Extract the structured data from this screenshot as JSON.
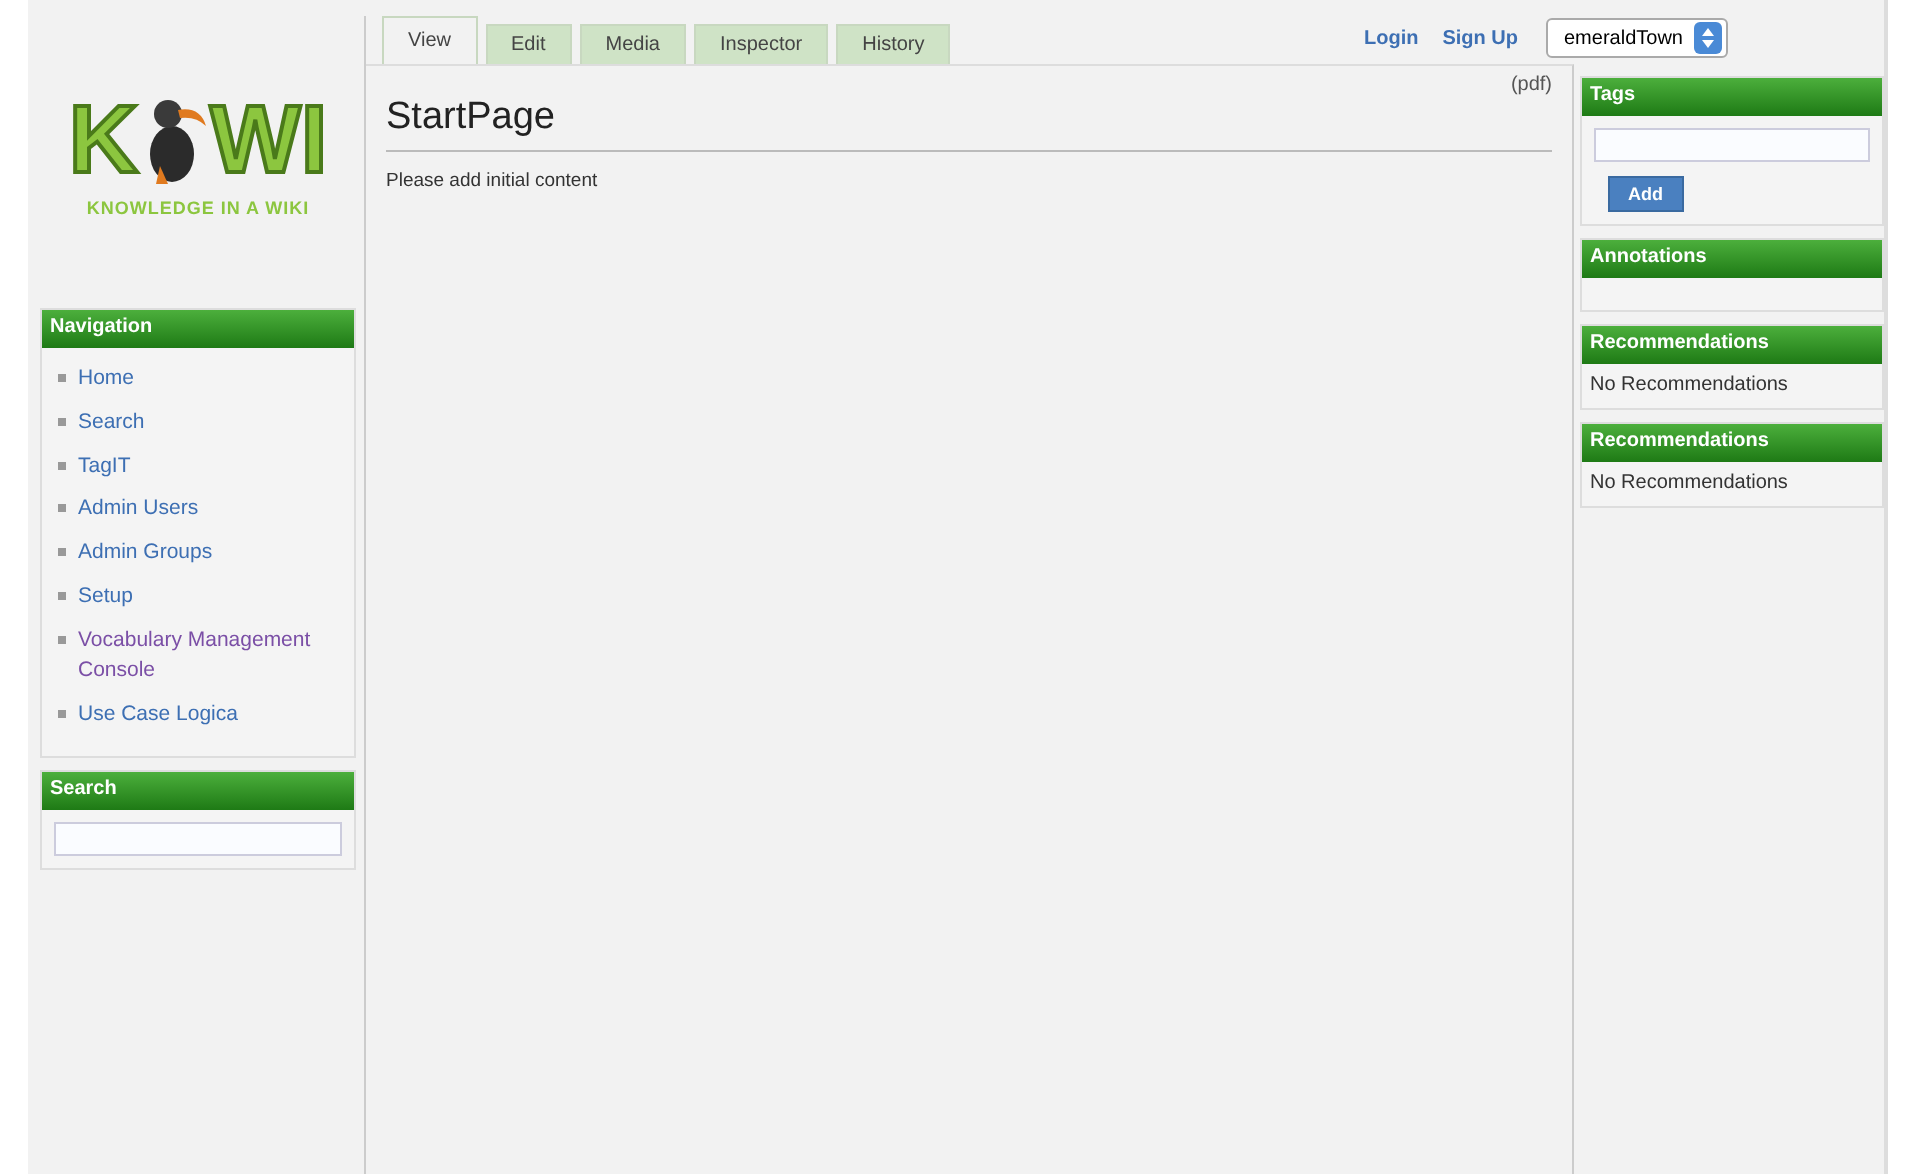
{
  "logo": {
    "left": "K",
    "right": "WI",
    "tagline": "KNOWLEDGE IN A WIKI"
  },
  "tabs": [
    {
      "label": "View",
      "selected": true
    },
    {
      "label": "Edit",
      "selected": false
    },
    {
      "label": "Media",
      "selected": false
    },
    {
      "label": "Inspector",
      "selected": false
    },
    {
      "label": "History",
      "selected": false
    }
  ],
  "header_links": [
    "Login",
    "Sign Up"
  ],
  "wiki_select": {
    "value": "emeraldTown"
  },
  "navigation": {
    "title": "Navigation",
    "items": [
      {
        "label": "Home",
        "visited": false
      },
      {
        "label": "Search",
        "visited": false
      },
      {
        "label": "TagIT",
        "visited": false
      },
      {
        "label": "Admin Users",
        "visited": false
      },
      {
        "label": "Admin Groups",
        "visited": false
      },
      {
        "label": "Setup",
        "visited": false
      },
      {
        "label": "Vocabulary Management Console",
        "visited": true
      },
      {
        "label": "Use Case Logica",
        "visited": false
      }
    ]
  },
  "search_panel": {
    "title": "Search"
  },
  "page": {
    "title": "StartPage",
    "pdf_link": "(pdf)",
    "body": "Please add initial content"
  },
  "tags_panel": {
    "title": "Tags",
    "button": "Add"
  },
  "annotations_panel": {
    "title": "Annotations"
  },
  "recommendation_panels": [
    {
      "title": "Recommendations",
      "text": "No Recommendations"
    },
    {
      "title": "Recommendations",
      "text": "No Recommendations"
    }
  ]
}
